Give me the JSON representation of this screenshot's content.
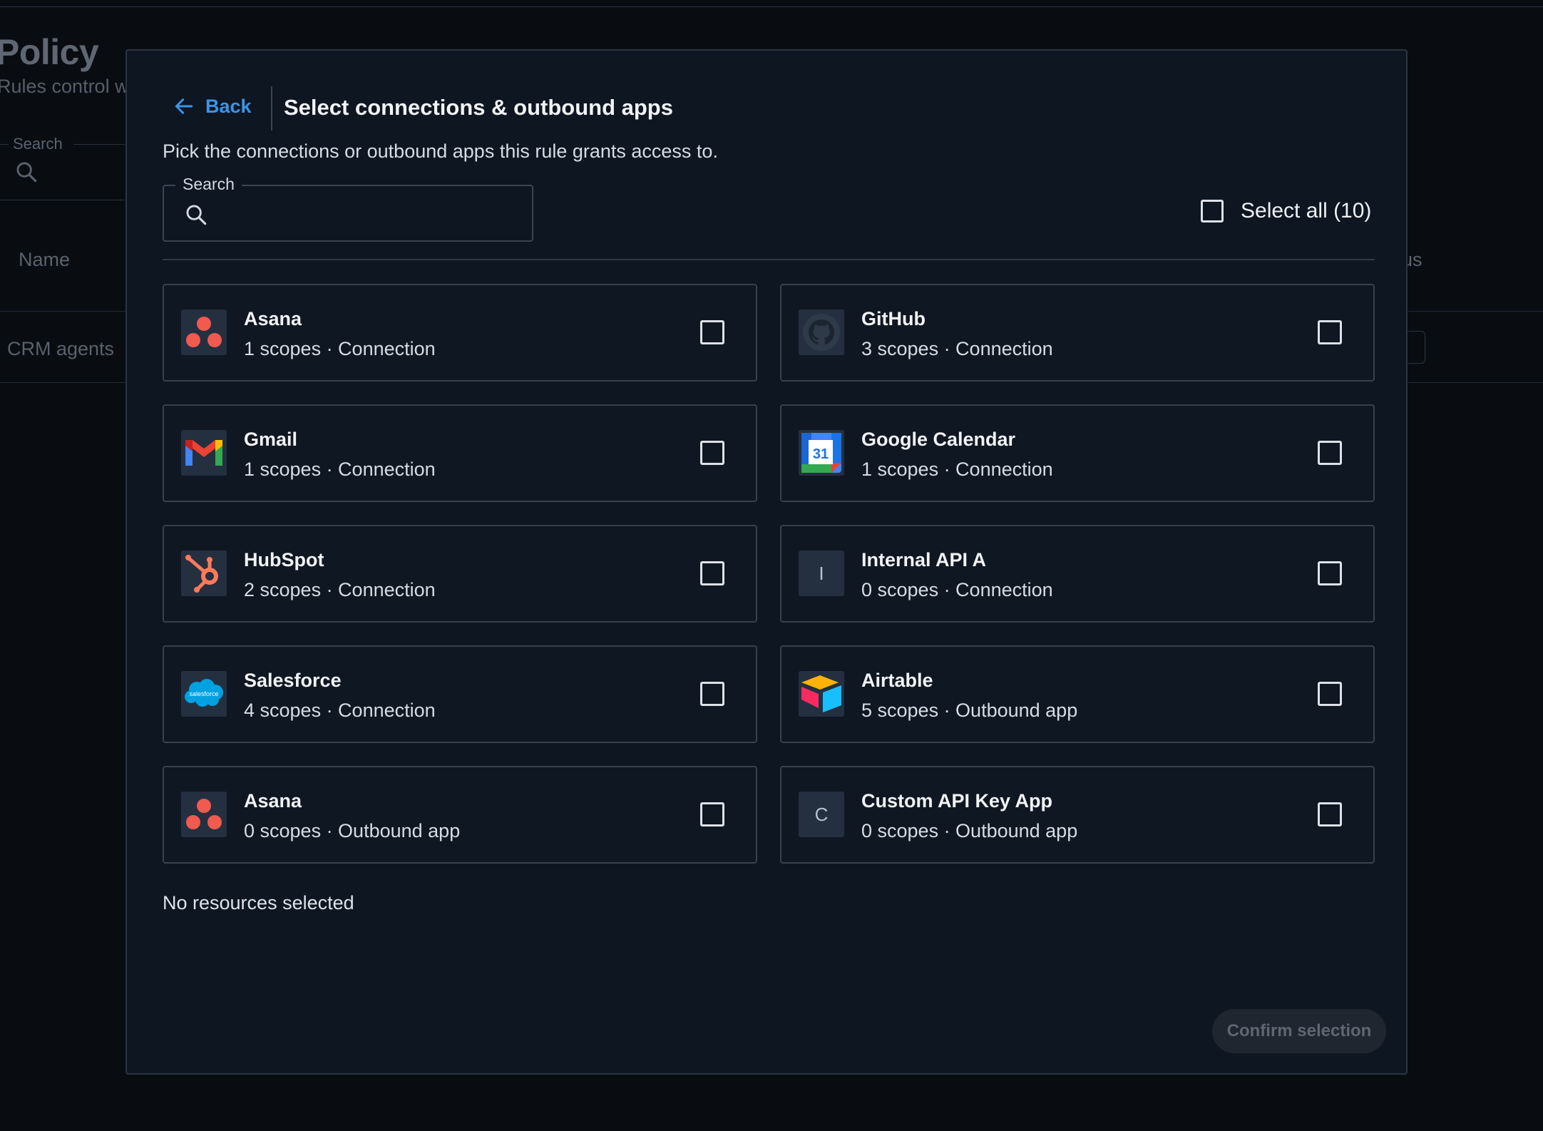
{
  "background": {
    "page_title": "Policy",
    "page_subtitle": "Rules control w",
    "search_label": "Search",
    "column_name": "Name",
    "column_status": "us",
    "row_name": "CRM agents"
  },
  "modal": {
    "back_label": "Back",
    "title": "Select connections & outbound apps",
    "description": "Pick the connections or outbound apps this rule grants access to.",
    "search": {
      "label": "Search",
      "value": "",
      "placeholder": ""
    },
    "select_all_label": "Select all (10)",
    "items": [
      {
        "name": "Asana",
        "meta": "1 scopes · Connection",
        "logo": "asana-logo",
        "checked": false
      },
      {
        "name": "GitHub",
        "meta": "3 scopes · Connection",
        "logo": "github-logo",
        "checked": false
      },
      {
        "name": "Gmail",
        "meta": "1 scopes · Connection",
        "logo": "gmail-logo",
        "checked": false
      },
      {
        "name": "Google Calendar",
        "meta": "1 scopes · Connection",
        "logo": "google-calendar-logo",
        "logo_text": "31",
        "checked": false
      },
      {
        "name": "HubSpot",
        "meta": "2 scopes · Connection",
        "logo": "hubspot-logo",
        "checked": false
      },
      {
        "name": "Internal API A",
        "meta": "0 scopes · Connection",
        "logo": "letter-logo",
        "logo_text": "I",
        "checked": false
      },
      {
        "name": "Salesforce",
        "meta": "4 scopes · Connection",
        "logo": "salesforce-logo",
        "logo_text": "salesforce",
        "checked": false
      },
      {
        "name": "Airtable",
        "meta": "5 scopes · Outbound app",
        "logo": "airtable-logo",
        "checked": false
      },
      {
        "name": "Asana",
        "meta": "0 scopes · Outbound app",
        "logo": "asana-logo",
        "checked": false
      },
      {
        "name": "Custom API Key App",
        "meta": "0 scopes · Outbound app",
        "logo": "letter-logo",
        "logo_text": "C",
        "checked": false
      }
    ],
    "status_text": "No resources selected",
    "confirm_label": "Confirm selection",
    "confirm_disabled": true
  },
  "colors": {
    "background": "#090d12",
    "modal_bg": "#0e1621",
    "accent": "#3b95e8",
    "border": "#37414e"
  }
}
